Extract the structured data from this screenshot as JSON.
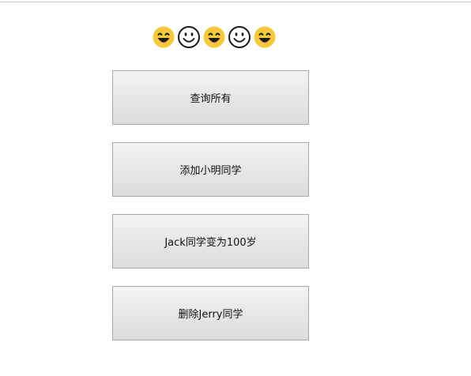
{
  "emojis": [
    "grinning-face",
    "smiling-face-outline",
    "grinning-face",
    "smiling-face-outline",
    "grinning-face"
  ],
  "colors": {
    "emoji_fill": "#f5c93b",
    "emoji_outline": "#1a1a1a",
    "button_border": "#a9a9a9",
    "button_top": "#f3f3f3",
    "button_bottom": "#dcdcdc"
  },
  "buttons": {
    "query_all": "查询所有",
    "add_xiaoming": "添加小明同学",
    "jack_age": "Jack同学变为100岁",
    "delete_jerry": "删除Jerry同学"
  }
}
